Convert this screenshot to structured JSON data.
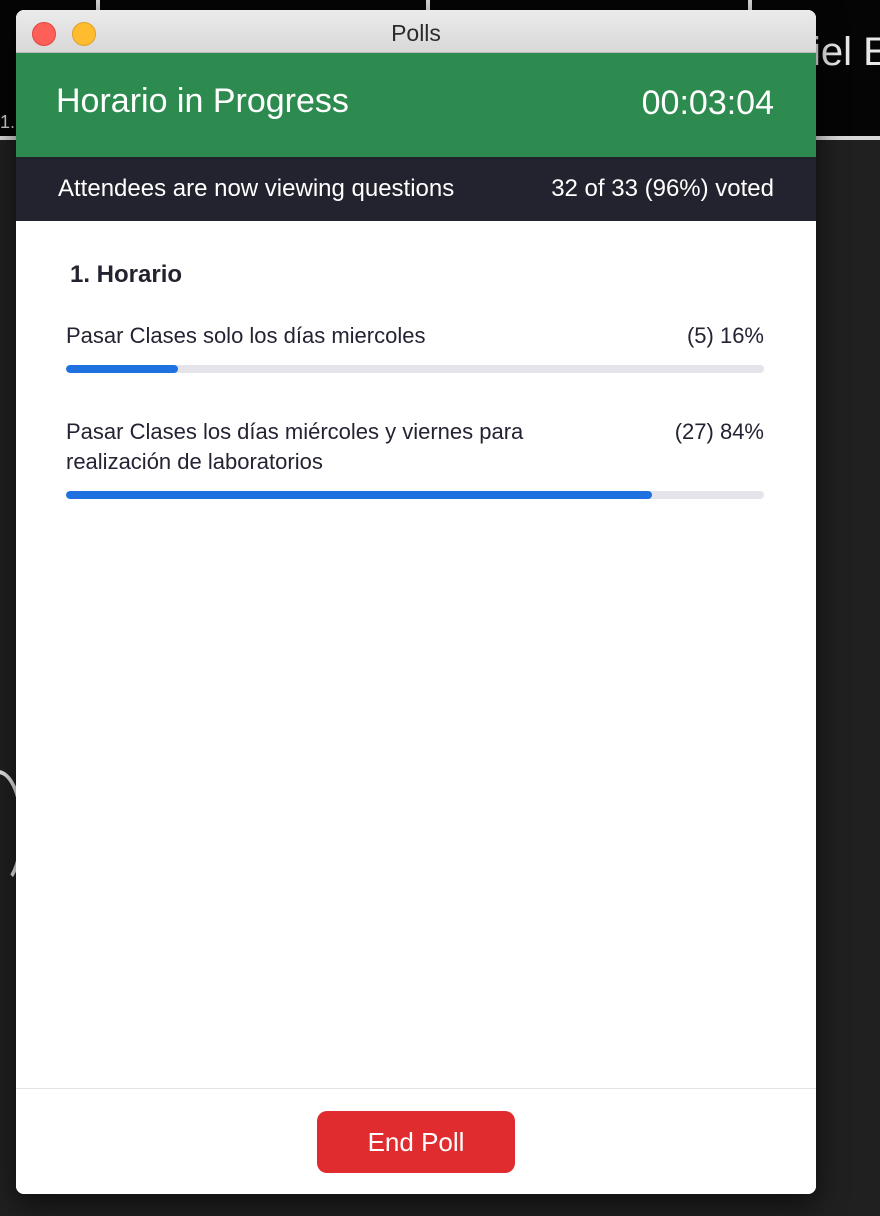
{
  "background": {
    "participant_name_partial": "iel E",
    "left_label_partial": "1."
  },
  "window": {
    "title": "Polls"
  },
  "status": {
    "poll_title": "Horario in Progress",
    "timer": "00:03:04",
    "color": "#2e8b4f"
  },
  "info_bar": {
    "message": "Attendees are now viewing questions",
    "vote_summary": "32 of 33 (96%) voted"
  },
  "question": {
    "title": "1. Horario",
    "answers": [
      {
        "text": "Pasar Clases solo los días miercoles",
        "result": "(5) 16%",
        "percent": 16
      },
      {
        "text": "Pasar Clases los días miércoles y viernes  para realización de laboratorios",
        "result": "(27) 84%",
        "percent": 84
      }
    ]
  },
  "footer": {
    "end_button_label": "End Poll",
    "button_color": "#e02b2f"
  },
  "accent_color": "#1f71e0"
}
